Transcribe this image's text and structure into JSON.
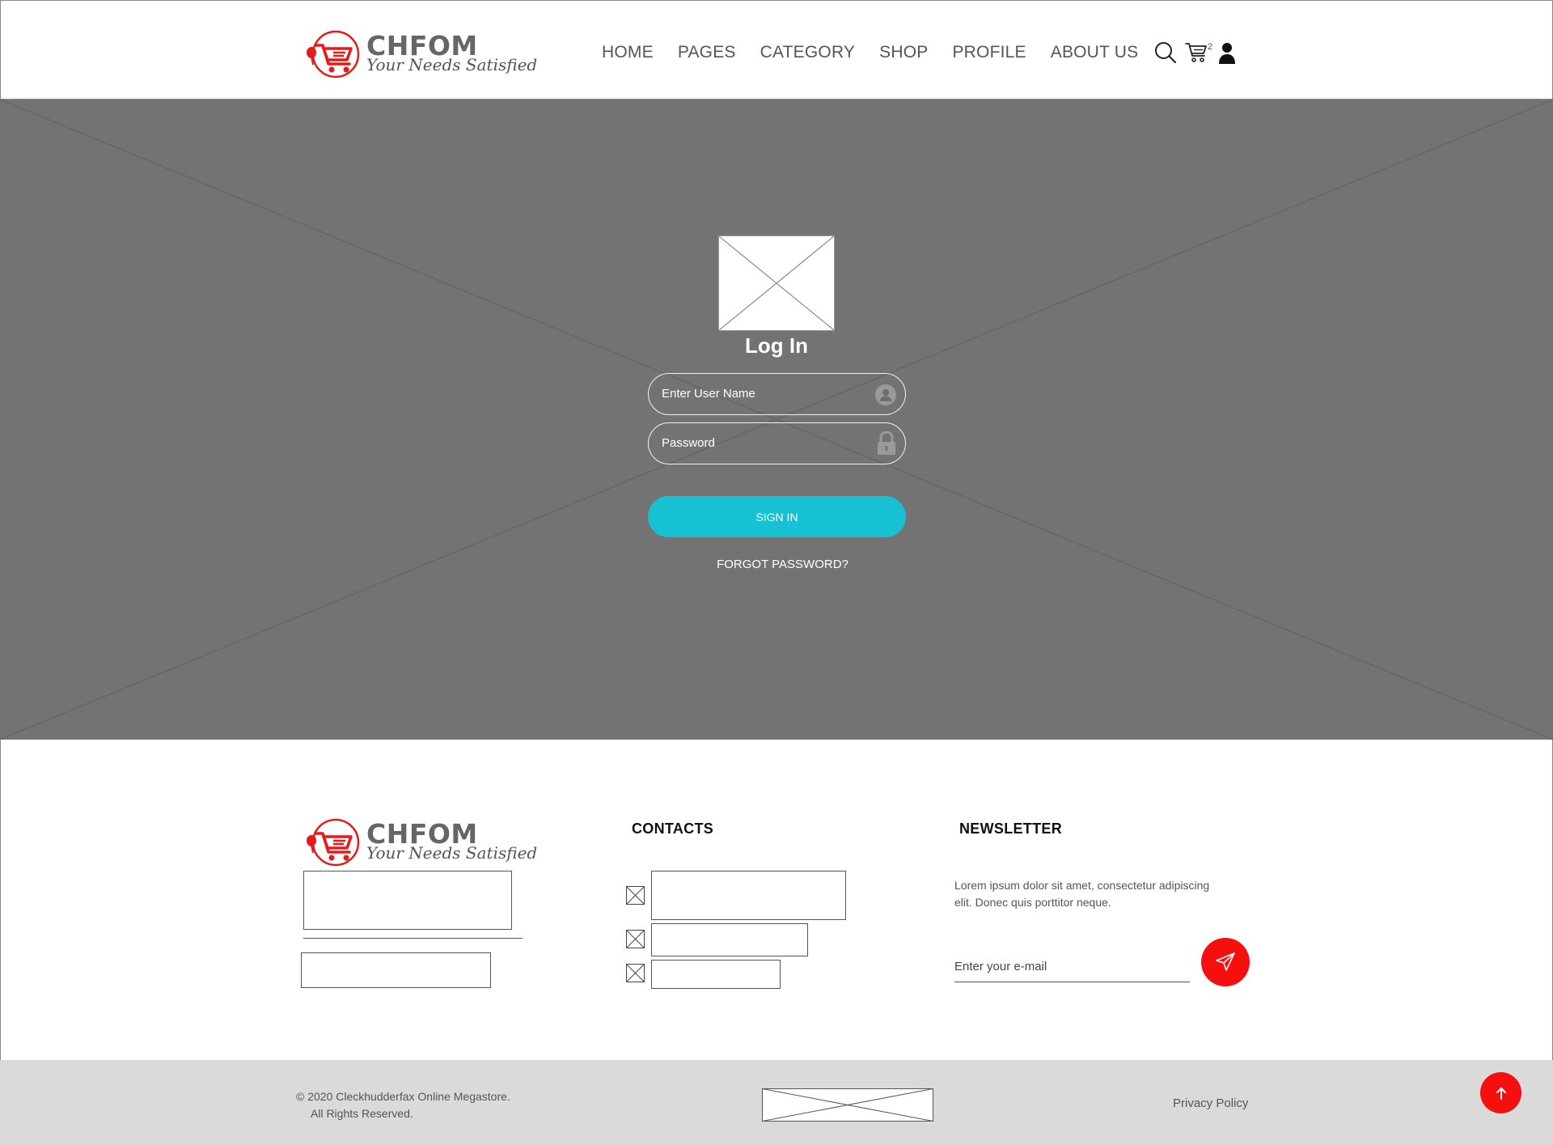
{
  "header": {
    "logo": {
      "brand": "CHFOM",
      "tagline": "Your Needs Satisfied",
      "accent_color": "#e41b1b",
      "icon": "shopping-cart-icon"
    },
    "nav": [
      "HOME",
      "PAGES",
      "CATEGORY",
      "SHOP",
      "PROFILE",
      "ABOUT US"
    ],
    "icons": [
      "search-icon",
      "cart-icon",
      "user-icon"
    ],
    "cart_count": "2"
  },
  "hero": {
    "background_color": "#737373",
    "image": "image-placeholder",
    "login_title": "Log In",
    "username_placeholder": "Enter User Name",
    "username_icon": "user-circle-icon",
    "password_placeholder": "Password",
    "password_icon": "lock-icon",
    "signin_label": "SIGN IN",
    "signin_color": "#16c1d4",
    "forgot_label": "FORGOT PASSWORD?"
  },
  "footer": {
    "logo": {
      "brand": "CHFOM",
      "tagline": "Your Needs Satisfied"
    },
    "contacts_title": "CONTACTS",
    "newsletter_title": "NEWSLETTER",
    "newsletter_text": "Lorem ipsum dolor sit amet, consectetur adipiscing elit. Donec quis porttitor neque.",
    "email_placeholder": "Enter your e-mail",
    "send_icon": "paper-plane-icon",
    "accent_color": "#f50f0f"
  },
  "bottom": {
    "copyright_line1": "© 2020 Cleckhudderfax Online Megastore.",
    "copyright_line2": "All Rights Reserved.",
    "privacy_label": "Privacy Policy",
    "totop_icon": "arrow-up-icon",
    "background_color": "#dadada"
  }
}
